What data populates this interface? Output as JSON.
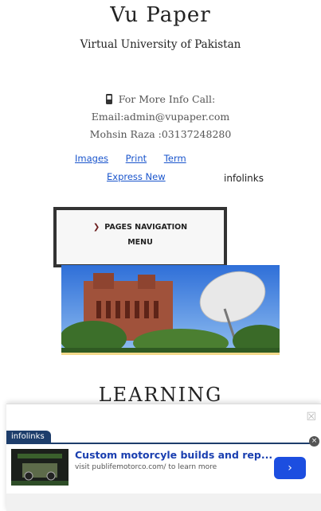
{
  "header": {
    "title": "Vu Paper",
    "subtitle": "Virtual University of Pakistan"
  },
  "contact": {
    "call_label": "For More Info Call:",
    "email": "Email:admin@vupaper.com",
    "phone": "Mohsin Raza :03137248280"
  },
  "links": {
    "images": "Images",
    "print": "Print",
    "term": "Term",
    "express_new": "Express New",
    "brand": "infolinks"
  },
  "nav_menu": {
    "line1": "PAGES NAVIGATION",
    "line2": "MENU"
  },
  "section": {
    "heading": "LEARNING"
  },
  "ad": {
    "tab_label": "infolinks",
    "close_symbol": "☒",
    "dismiss_symbol": "×",
    "title": "Custom motorcyle builds and rep...",
    "url": "visit publifemotorco.com/ to learn more",
    "go_symbol": "›"
  },
  "colors": {
    "link": "#1a55cc",
    "ad_accent": "#1d3d6b",
    "ad_button": "#1c4ee0",
    "hero_underline": "#f3d98a"
  }
}
